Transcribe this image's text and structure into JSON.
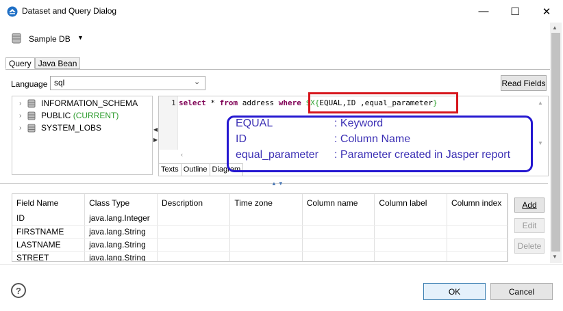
{
  "window": {
    "title": "Dataset and Query Dialog",
    "minimize_glyph": "—",
    "maximize_glyph": "☐",
    "close_glyph": "✕"
  },
  "datasource": {
    "label": "Sample DB"
  },
  "tabs": [
    {
      "label": "Query"
    },
    {
      "label": "Java Bean"
    }
  ],
  "language": {
    "label": "Language",
    "value": "sql"
  },
  "read_fields_label": "Read Fields",
  "tree": [
    {
      "name": "INFORMATION_SCHEMA",
      "suffix": ""
    },
    {
      "name": "PUBLIC",
      "suffix": "(CURRENT)"
    },
    {
      "name": "SYSTEM_LOBS",
      "suffix": ""
    }
  ],
  "editor": {
    "line_number": "1",
    "kw_select": "select",
    "star": " * ",
    "kw_from": "from",
    "table": " address ",
    "kw_where": "where",
    "space": " ",
    "param_open": "$X{",
    "param_body": "EQUAL,ID ,equal_parameter",
    "param_close": "}",
    "subtabs": [
      "Texts",
      "Outline",
      "Diagram"
    ]
  },
  "annotations": [
    {
      "term": "EQUAL",
      "meaning": ": Keyword"
    },
    {
      "term": "ID",
      "meaning": ": Column Name"
    },
    {
      "term": "equal_parameter",
      "meaning": ": Parameter created in Jasper report"
    }
  ],
  "fields_table": {
    "columns": [
      "Field Name",
      "Class Type",
      "Description",
      "Time zone",
      "Column name",
      "Column label",
      "Column index"
    ],
    "rows": [
      [
        "ID",
        "java.lang.Integer"
      ],
      [
        "FIRSTNAME",
        "java.lang.String"
      ],
      [
        "LASTNAME",
        "java.lang.String"
      ],
      [
        "STREET",
        "java.lang.String"
      ]
    ]
  },
  "side_buttons": {
    "add": "Add",
    "edit": "Edit",
    "delete": "Delete"
  },
  "footer": {
    "help_glyph": "?",
    "ok": "OK",
    "cancel": "Cancel"
  },
  "colors": {
    "annotation_red": "#d6151c",
    "annotation_blue": "#2417d0",
    "annotation_text": "#3b2fb4",
    "sql_keyword": "#7f0055",
    "param": "#3aa63a"
  }
}
